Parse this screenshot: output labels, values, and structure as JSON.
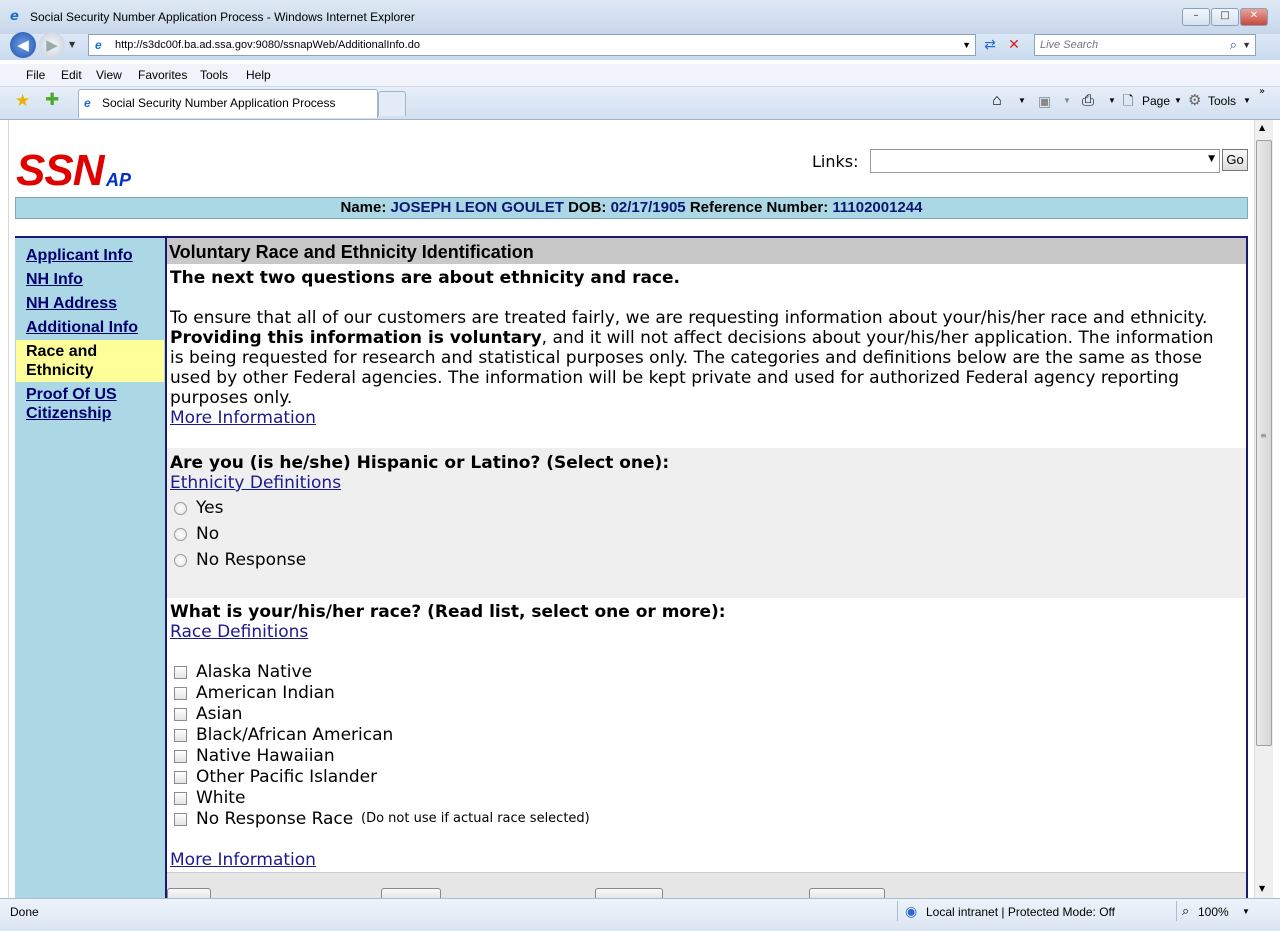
{
  "window": {
    "title": "Social Security Number Application Process - Windows Internet Explorer"
  },
  "browser": {
    "address": "http://s3dc00f.ba.ad.ssa.gov:9080/ssnapWeb/AdditionalInfo.do",
    "search_placeholder": "Live Search",
    "menu": [
      "File",
      "Edit",
      "View",
      "Favorites",
      "Tools",
      "Help"
    ],
    "tab_title": "Social Security Number Application Process",
    "toolbar": {
      "page_label": "Page",
      "tools_label": "Tools"
    },
    "status": {
      "left": "Done",
      "zone": "Local intranet | Protected Mode: Off",
      "zoom": "100%"
    }
  },
  "header": {
    "logo_main": "SSN",
    "logo_sub": "AP",
    "links_label": "Links:",
    "go_label": "Go"
  },
  "applicant": {
    "name_label": "Name:",
    "name": "JOSEPH LEON GOULET",
    "dob_label": "DOB:",
    "dob": "02/17/1905",
    "ref_label": "Reference Number:",
    "ref": "11102001244"
  },
  "sidebar": {
    "items": [
      {
        "label": "Applicant Info"
      },
      {
        "label": "NH Info"
      },
      {
        "label": "NH Address"
      },
      {
        "label": "Additional Info"
      },
      {
        "label_line1": "Race and",
        "label_line2": "Ethnicity"
      },
      {
        "label_line1": "Proof Of US",
        "label_line2": "Citizenship"
      }
    ]
  },
  "main": {
    "section_title": "Voluntary Race and Ethnicity Identification",
    "intro_heading": "The next two questions are about ethnicity and race.",
    "para_line1": "To ensure that all of our customers are treated fairly, we are requesting information about your/his/her race and ethnicity.",
    "para_bold": "Providing this information is voluntary",
    "para_line2_rest": ", and it will not affect decisions about your/his/her application. The information",
    "para_line3": "is being requested for research and statistical purposes only. The categories and definitions below are the same as those",
    "para_line4": "used by other Federal agencies. The information will be kept private and used for authorized Federal agency reporting",
    "para_line5": "purposes only.",
    "more_info_1": "More Information",
    "ethnicity_question": "Are you (is he/she) Hispanic or Latino? (Select one):",
    "ethnicity_link": "Ethnicity Definitions",
    "ethnicity_options": [
      "Yes",
      "No",
      "No Response"
    ],
    "race_question": "What is your/his/her race? (Read list, select one or more):",
    "race_link": "Race Definitions",
    "race_options": [
      "Alaska Native",
      "American Indian",
      "Asian",
      "Black/African American",
      "Native Hawaiian",
      "Other Pacific Islander",
      "White",
      "No Response Race"
    ],
    "race_note": "(Do not use if actual race selected)",
    "more_info_2": "More Information"
  }
}
